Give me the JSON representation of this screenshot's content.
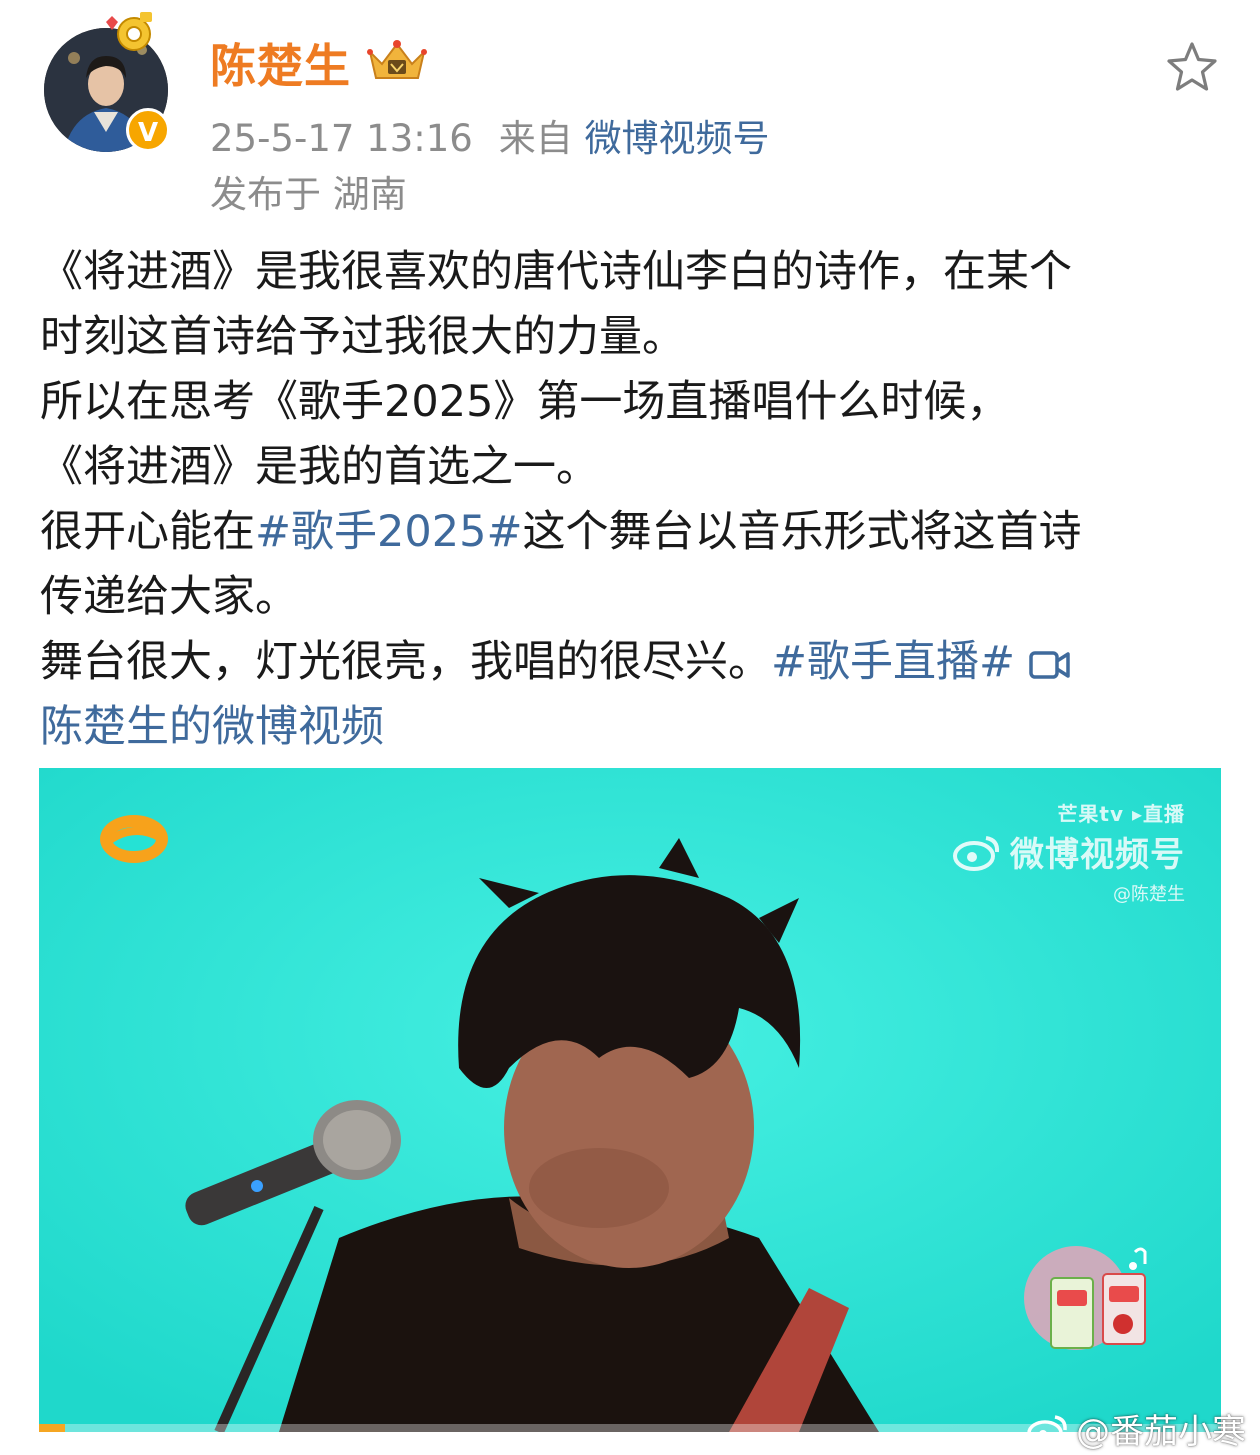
{
  "post": {
    "username": "陈楚生",
    "timestamp": "25-5-17 13:16",
    "source_prefix": "来自",
    "source_name": "微博视频号",
    "location": "发布于 湖南",
    "text": {
      "l1": "《将进酒》是我很喜欢的唐代诗仙李白的诗作，在某个",
      "l2": "时刻这首诗给予过我很大的力量。",
      "l3": "所以在思考《歌手2025》第一场直播唱什么时候，",
      "l4": "《将进酒》是我的首选之一。",
      "l5_a": "很开心能在",
      "l5_tag": "#歌手2025#",
      "l5_b": "这个舞台以音乐形式将这首诗",
      "l6": "传递给大家。",
      "l7_a": "舞台很大，灯光很亮，我唱的很尽兴。",
      "l7_tag": "#歌手直播#",
      "video_link": "陈楚生的微博视频"
    }
  },
  "icons": {
    "verified": "verified-v-badge-icon",
    "vip": "vip-crown-icon",
    "favorite": "star-outline-icon",
    "video_link": "video-camera-icon"
  },
  "video": {
    "watermark_top": "芒果tv ▸直播",
    "watermark_main": "微博视频号",
    "watermark_handle": "@陈楚生",
    "progress": 0.022,
    "background_color": "#25e2d5"
  },
  "footer_watermark": "@番茄小寒",
  "colors": {
    "username": "#ee7b22",
    "link": "#3f6a9c",
    "meta": "#8c8c8c"
  }
}
